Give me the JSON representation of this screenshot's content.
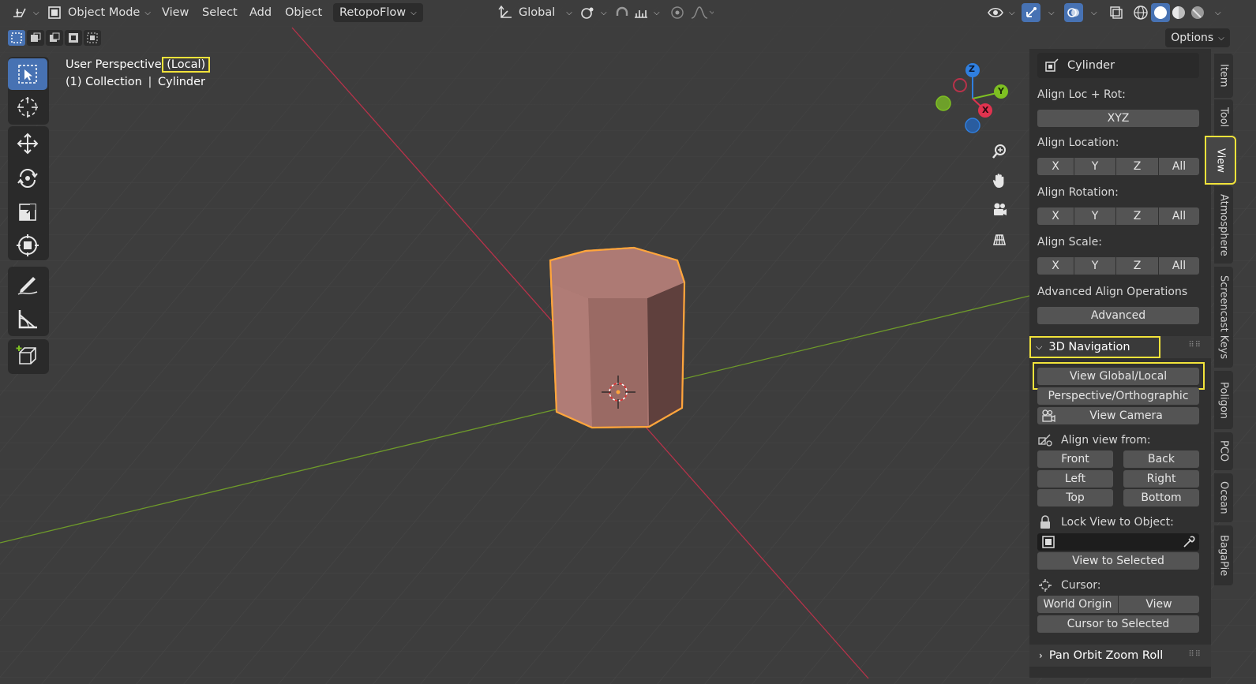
{
  "header": {
    "mode_label": "Object Mode",
    "menu": [
      "View",
      "Select",
      "Add",
      "Object"
    ],
    "retopoflow_label": "RetopoFlow",
    "orientation_label": "Global",
    "options_label": "Options"
  },
  "viewport": {
    "perspective_label": "User Perspective",
    "local_label": "(Local)",
    "collection_label": "(1) Collection",
    "object_label": "Cylinder",
    "gizmo": {
      "x": "X",
      "y": "Y",
      "z": "Z"
    }
  },
  "npanel": {
    "object_name": "Cylinder",
    "align_loc_rot_label": "Align Loc + Rot:",
    "xyz_button": "XYZ",
    "align_location_label": "Align Location:",
    "align_rotation_label": "Align Rotation:",
    "align_scale_label": "Align Scale:",
    "axis_buttons": [
      "X",
      "Y",
      "Z",
      "All"
    ],
    "advanced_ops_label": "Advanced Align Operations",
    "advanced_button": "Advanced",
    "nav_section_title": "3D Navigation",
    "view_global_local": "View Global/Local",
    "persp_ortho": "Perspective/Orthographic",
    "view_camera": "View Camera",
    "align_view_from_label": "Align view from:",
    "align_views": [
      "Front",
      "Back",
      "Left",
      "Right",
      "Top",
      "Bottom"
    ],
    "lock_view_label": "Lock View to Object:",
    "view_to_selected": "View to Selected",
    "cursor_label": "Cursor:",
    "world_origin": "World Origin",
    "cursor_view": "View",
    "cursor_to_selected": "Cursor to Selected",
    "pan_orbit_section": "Pan Orbit Zoom Roll"
  },
  "tabs": [
    "Item",
    "Tool",
    "View",
    "Atmosphere",
    "Screencast Keys",
    "Poligon",
    "PCO",
    "Ocean",
    "BagaPie"
  ],
  "active_tab": "View",
  "colors": {
    "highlight": "#f2e33a",
    "selection": "#ffa53c",
    "active_tool": "#4772b3",
    "x_axis": "#e0334f",
    "y_axis": "#7ec022",
    "z_axis": "#2f7fe0"
  }
}
